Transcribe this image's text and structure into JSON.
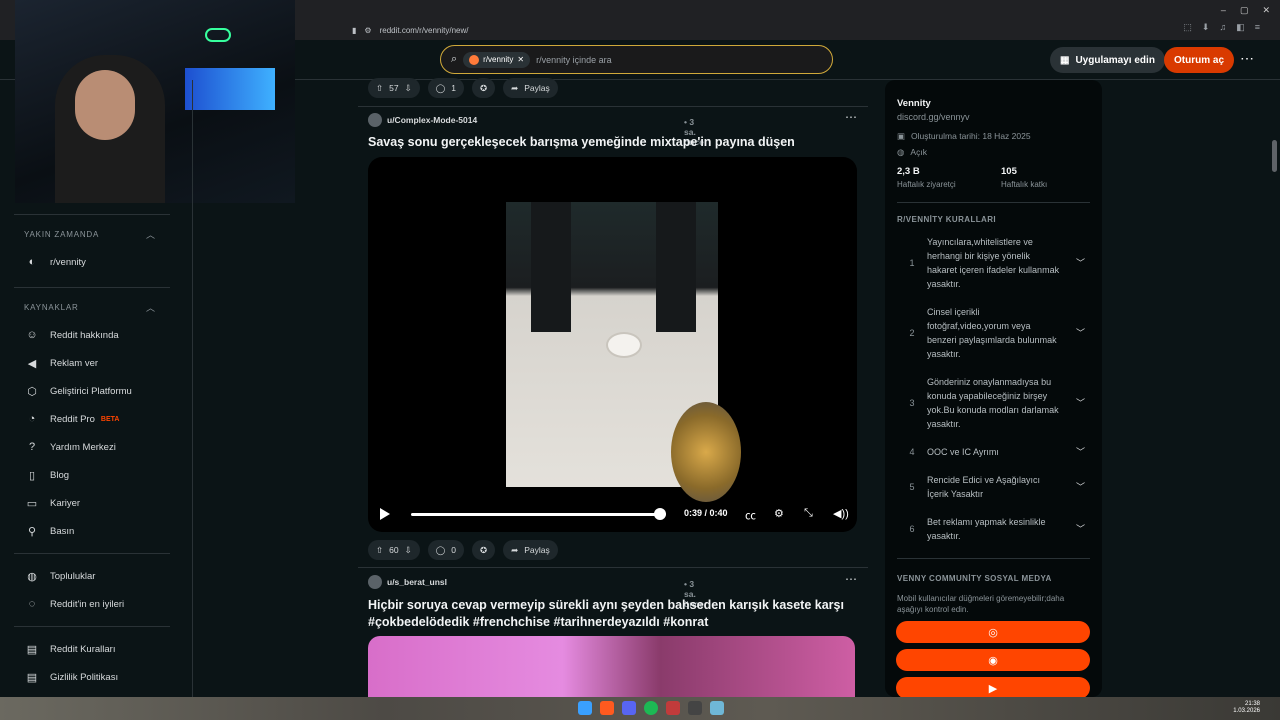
{
  "browser": {
    "url": "reddit.com/r/vennity/new/"
  },
  "header": {
    "subreddit_chip": "r/vennity",
    "search_placeholder": "r/vennity içinde ara",
    "get_app": "Uygulamayı edin",
    "login": "Oturum aç"
  },
  "sidebar": {
    "recent_heading": "YAKIN ZAMANDA",
    "recent_items": [
      {
        "label": "r/vennity"
      }
    ],
    "resources_heading": "KAYNAKLAR",
    "resources": [
      {
        "label": "Reddit hakkında",
        "icon": "reddit-icon"
      },
      {
        "label": "Reklam ver",
        "icon": "megaphone-icon"
      },
      {
        "label": "Geliştirici Platformu",
        "icon": "developer-platform-icon"
      },
      {
        "label": "Reddit Pro",
        "icon": "pro-icon",
        "badge": "BETA"
      },
      {
        "label": "Yardım Merkezi",
        "icon": "help-icon"
      },
      {
        "label": "Blog",
        "icon": "book-icon"
      },
      {
        "label": "Kariyer",
        "icon": "briefcase-icon"
      },
      {
        "label": "Basın",
        "icon": "microphone-icon"
      }
    ],
    "community_links": [
      {
        "label": "Topluluklar",
        "icon": "communities-icon"
      },
      {
        "label": "Reddit'in en iyileri",
        "icon": "best-of-icon"
      }
    ],
    "policy_links": [
      {
        "label": "Reddit Kuralları",
        "icon": "rules-icon"
      },
      {
        "label": "Gizlilik Politikası",
        "icon": "privacy-icon"
      }
    ]
  },
  "feed": {
    "top_actions": {
      "votes": "57",
      "comments": "1",
      "share": "Paylaş"
    },
    "posts": [
      {
        "user": "u/Complex-Mode-5014",
        "time": "• 3 sa. önce",
        "title": "Savaş sonu gerçekleşecek barışma yemeğinde mixtape'in payına düşen",
        "video_time": "0:39 / 0:40",
        "video_progress": 0.975,
        "votes": "60",
        "comments": "0",
        "share": "Paylaş"
      },
      {
        "user": "u/s_berat_unsl",
        "time": "• 3 sa. önce",
        "title_line1": "Hiçbir soruya cevap vermeyip sürekli aynı şeyden bahseden karışık kasete karşı",
        "title_line2": "#çokbedelödedik #frenchchise #tarihnerdeyazıldı #konrat"
      }
    ]
  },
  "community": {
    "name": "Vennity",
    "link": "discord.gg/vennyv",
    "created": "Oluşturulma tarihi: 18 Haz 2025",
    "visibility": "Açık",
    "weekly_visitors": "2,3 B",
    "weekly_visitors_label": "Haftalık ziyaretçi",
    "weekly_contributions": "105",
    "weekly_contributions_label": "Haftalık katkı",
    "rules_heading": "R/VENNİTY KURALLARI",
    "rules": [
      {
        "num": "1",
        "text": "Yayıncılara,whitelistlere ve herhangi bir kişiye yönelik hakaret içeren ifadeler kullanmak yasaktır."
      },
      {
        "num": "2",
        "text": "Cinsel içerikli fotoğraf,video,yorum veya benzeri paylaşımlarda bulunmak yasaktır."
      },
      {
        "num": "3",
        "text": "Gönderiniz onaylanmadıysa bu konuda yapabileceğiniz birşey yok.Bu konuda modları darlamak yasaktır."
      },
      {
        "num": "4",
        "text": "OOC ve IC Ayrımı"
      },
      {
        "num": "5",
        "text": "Rencide Edici ve Aşağılayıcı İçerik Yasaktır"
      },
      {
        "num": "6",
        "text": "Bet reklamı yapmak kesinlikle yasaktır."
      }
    ],
    "social_heading": "VENNY COMMUNİTY SOSYAL MEDYA",
    "social_note": "Mobil kullanıcılar düğmeleri göremeyebilir;daha aşağıyı kontrol edin.",
    "social_buttons": [
      {
        "icon": "globe-icon"
      },
      {
        "icon": "discord-icon"
      },
      {
        "icon": "youtube-icon"
      }
    ]
  },
  "taskbar": {
    "time": "21:38",
    "date": "1.03.2026"
  },
  "colors": {
    "accent": "#ff4500",
    "background": "#0b1416",
    "search_border": "#d0a93a"
  }
}
